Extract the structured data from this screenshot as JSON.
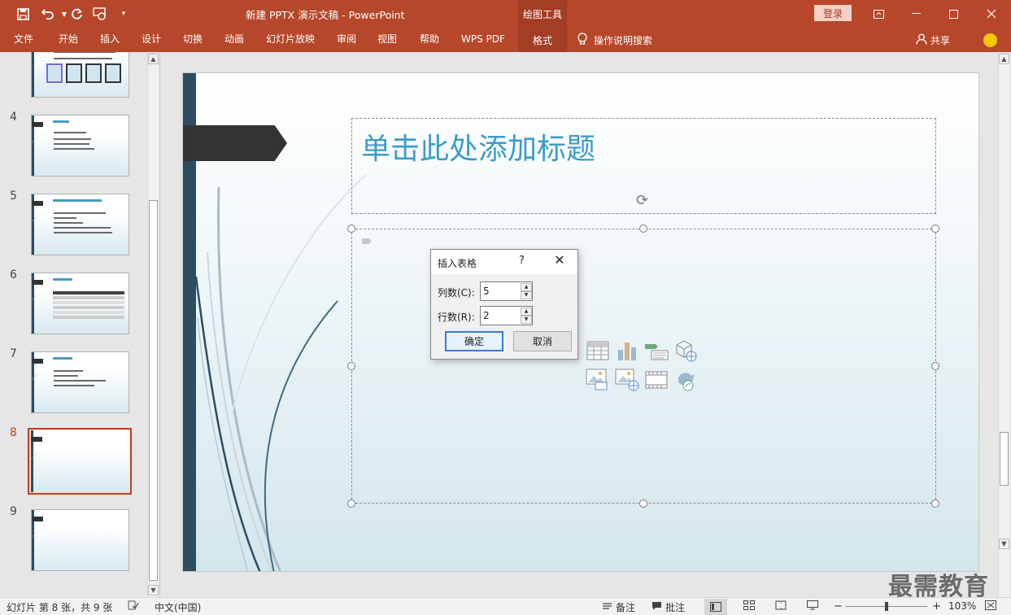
{
  "app": {
    "doc_title": "新建 PPTX 演示文稿  -  PowerPoint",
    "context_tab_group": "绘图工具",
    "login_label": "登录"
  },
  "quick_access": {
    "icons": [
      "save-icon",
      "undo-icon",
      "redo-icon",
      "start-from-beginning-icon",
      "customize-qat-icon"
    ]
  },
  "ribbon": {
    "tabs": [
      "文件",
      "开始",
      "插入",
      "设计",
      "切换",
      "动画",
      "幻灯片放映",
      "审阅",
      "视图",
      "帮助",
      "WPS PDF"
    ],
    "active_tab": "格式",
    "tell_me": "操作说明搜索",
    "share": "共享"
  },
  "thumbnails": {
    "numbers": [
      "4",
      "5",
      "6",
      "7",
      "8",
      "9"
    ],
    "selected": "8",
    "accent_color": "#c43e1c"
  },
  "slide": {
    "title_placeholder": "单击此处添加标题",
    "insert_icons": [
      "table-icon",
      "chart-icon",
      "smartart-icon",
      "3d-model-icon",
      "picture-icon",
      "online-picture-icon",
      "video-icon",
      "icons-icon"
    ]
  },
  "dialog": {
    "title": "插入表格",
    "help": "?",
    "close": "✕",
    "columns_label": "列数(C):",
    "columns_value": "5",
    "rows_label": "行数(R):",
    "rows_value": "2",
    "ok": "确定",
    "cancel": "取消"
  },
  "statusbar": {
    "slide_info": "幻灯片 第 8 张，共 9 张",
    "language": "中文(中国)",
    "notes": "备注",
    "comments": "批注",
    "zoom": "103%"
  },
  "watermark": "最需教育",
  "colors": {
    "brand": "#b7472a",
    "title_text": "#3b9dc9",
    "slide_bar": "#2c4d62"
  }
}
